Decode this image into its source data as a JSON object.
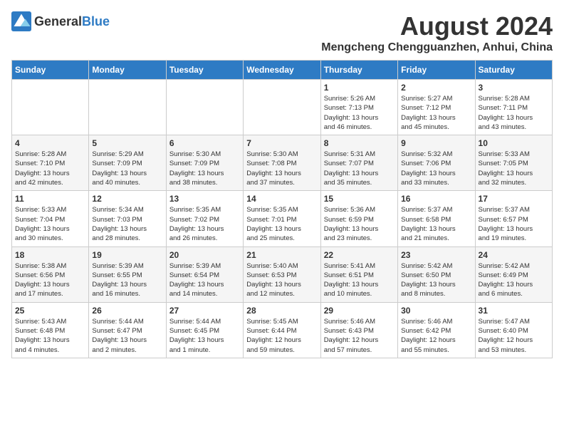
{
  "header": {
    "logo_general": "General",
    "logo_blue": "Blue",
    "month_title": "August 2024",
    "location": "Mengcheng Chengguanzhen, Anhui, China"
  },
  "weekdays": [
    "Sunday",
    "Monday",
    "Tuesday",
    "Wednesday",
    "Thursday",
    "Friday",
    "Saturday"
  ],
  "weeks": [
    [
      {
        "day": "",
        "info": ""
      },
      {
        "day": "",
        "info": ""
      },
      {
        "day": "",
        "info": ""
      },
      {
        "day": "",
        "info": ""
      },
      {
        "day": "1",
        "info": "Sunrise: 5:26 AM\nSunset: 7:13 PM\nDaylight: 13 hours\nand 46 minutes."
      },
      {
        "day": "2",
        "info": "Sunrise: 5:27 AM\nSunset: 7:12 PM\nDaylight: 13 hours\nand 45 minutes."
      },
      {
        "day": "3",
        "info": "Sunrise: 5:28 AM\nSunset: 7:11 PM\nDaylight: 13 hours\nand 43 minutes."
      }
    ],
    [
      {
        "day": "4",
        "info": "Sunrise: 5:28 AM\nSunset: 7:10 PM\nDaylight: 13 hours\nand 42 minutes."
      },
      {
        "day": "5",
        "info": "Sunrise: 5:29 AM\nSunset: 7:09 PM\nDaylight: 13 hours\nand 40 minutes."
      },
      {
        "day": "6",
        "info": "Sunrise: 5:30 AM\nSunset: 7:09 PM\nDaylight: 13 hours\nand 38 minutes."
      },
      {
        "day": "7",
        "info": "Sunrise: 5:30 AM\nSunset: 7:08 PM\nDaylight: 13 hours\nand 37 minutes."
      },
      {
        "day": "8",
        "info": "Sunrise: 5:31 AM\nSunset: 7:07 PM\nDaylight: 13 hours\nand 35 minutes."
      },
      {
        "day": "9",
        "info": "Sunrise: 5:32 AM\nSunset: 7:06 PM\nDaylight: 13 hours\nand 33 minutes."
      },
      {
        "day": "10",
        "info": "Sunrise: 5:33 AM\nSunset: 7:05 PM\nDaylight: 13 hours\nand 32 minutes."
      }
    ],
    [
      {
        "day": "11",
        "info": "Sunrise: 5:33 AM\nSunset: 7:04 PM\nDaylight: 13 hours\nand 30 minutes."
      },
      {
        "day": "12",
        "info": "Sunrise: 5:34 AM\nSunset: 7:03 PM\nDaylight: 13 hours\nand 28 minutes."
      },
      {
        "day": "13",
        "info": "Sunrise: 5:35 AM\nSunset: 7:02 PM\nDaylight: 13 hours\nand 26 minutes."
      },
      {
        "day": "14",
        "info": "Sunrise: 5:35 AM\nSunset: 7:01 PM\nDaylight: 13 hours\nand 25 minutes."
      },
      {
        "day": "15",
        "info": "Sunrise: 5:36 AM\nSunset: 6:59 PM\nDaylight: 13 hours\nand 23 minutes."
      },
      {
        "day": "16",
        "info": "Sunrise: 5:37 AM\nSunset: 6:58 PM\nDaylight: 13 hours\nand 21 minutes."
      },
      {
        "day": "17",
        "info": "Sunrise: 5:37 AM\nSunset: 6:57 PM\nDaylight: 13 hours\nand 19 minutes."
      }
    ],
    [
      {
        "day": "18",
        "info": "Sunrise: 5:38 AM\nSunset: 6:56 PM\nDaylight: 13 hours\nand 17 minutes."
      },
      {
        "day": "19",
        "info": "Sunrise: 5:39 AM\nSunset: 6:55 PM\nDaylight: 13 hours\nand 16 minutes."
      },
      {
        "day": "20",
        "info": "Sunrise: 5:39 AM\nSunset: 6:54 PM\nDaylight: 13 hours\nand 14 minutes."
      },
      {
        "day": "21",
        "info": "Sunrise: 5:40 AM\nSunset: 6:53 PM\nDaylight: 13 hours\nand 12 minutes."
      },
      {
        "day": "22",
        "info": "Sunrise: 5:41 AM\nSunset: 6:51 PM\nDaylight: 13 hours\nand 10 minutes."
      },
      {
        "day": "23",
        "info": "Sunrise: 5:42 AM\nSunset: 6:50 PM\nDaylight: 13 hours\nand 8 minutes."
      },
      {
        "day": "24",
        "info": "Sunrise: 5:42 AM\nSunset: 6:49 PM\nDaylight: 13 hours\nand 6 minutes."
      }
    ],
    [
      {
        "day": "25",
        "info": "Sunrise: 5:43 AM\nSunset: 6:48 PM\nDaylight: 13 hours\nand 4 minutes."
      },
      {
        "day": "26",
        "info": "Sunrise: 5:44 AM\nSunset: 6:47 PM\nDaylight: 13 hours\nand 2 minutes."
      },
      {
        "day": "27",
        "info": "Sunrise: 5:44 AM\nSunset: 6:45 PM\nDaylight: 13 hours\nand 1 minute."
      },
      {
        "day": "28",
        "info": "Sunrise: 5:45 AM\nSunset: 6:44 PM\nDaylight: 12 hours\nand 59 minutes."
      },
      {
        "day": "29",
        "info": "Sunrise: 5:46 AM\nSunset: 6:43 PM\nDaylight: 12 hours\nand 57 minutes."
      },
      {
        "day": "30",
        "info": "Sunrise: 5:46 AM\nSunset: 6:42 PM\nDaylight: 12 hours\nand 55 minutes."
      },
      {
        "day": "31",
        "info": "Sunrise: 5:47 AM\nSunset: 6:40 PM\nDaylight: 12 hours\nand 53 minutes."
      }
    ]
  ]
}
